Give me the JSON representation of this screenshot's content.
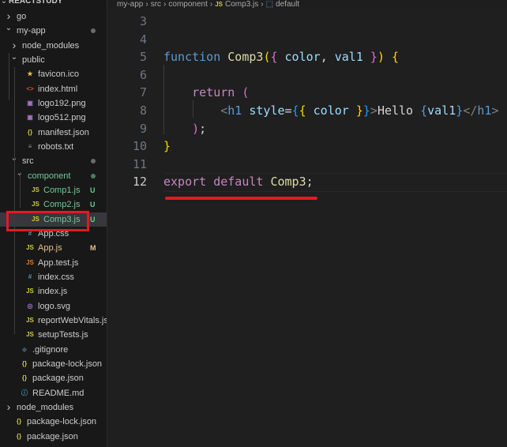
{
  "explorer": {
    "root_label": "REACTSTUDY",
    "items": [
      {
        "label": "go",
        "kind": "folder",
        "depth": 0,
        "collapsed": true
      },
      {
        "label": "my-app",
        "kind": "folder",
        "depth": 0,
        "collapsed": false,
        "dot": true
      },
      {
        "label": "node_modules",
        "kind": "folder",
        "depth": 1,
        "collapsed": true
      },
      {
        "label": "public",
        "kind": "folder",
        "depth": 1,
        "collapsed": false
      },
      {
        "label": "favicon.ico",
        "kind": "file",
        "depth": 2,
        "icon": "★",
        "icon_color": "#e8c44b"
      },
      {
        "label": "index.html",
        "kind": "file",
        "depth": 2,
        "icon": "<>",
        "icon_color": "#e44d26"
      },
      {
        "label": "logo192.png",
        "kind": "file",
        "depth": 2,
        "icon": "▣",
        "icon_color": "#a074c4"
      },
      {
        "label": "logo512.png",
        "kind": "file",
        "depth": 2,
        "icon": "▣",
        "icon_color": "#a074c4"
      },
      {
        "label": "manifest.json",
        "kind": "file",
        "depth": 2,
        "icon": "{}",
        "icon_color": "#cbcb41"
      },
      {
        "label": "robots.txt",
        "kind": "file",
        "depth": 2,
        "icon": "≡",
        "icon_color": "#8e8e8e"
      },
      {
        "label": "src",
        "kind": "folder",
        "depth": 1,
        "collapsed": false,
        "dot": true
      },
      {
        "label": "component",
        "kind": "folder",
        "depth": 2,
        "collapsed": false,
        "dot": true,
        "label_color": "#73c991"
      },
      {
        "label": "Comp1.js",
        "kind": "file",
        "depth": 3,
        "icon": "JS",
        "icon_color": "#cbcb41",
        "label_color": "#73c991",
        "badge": "U"
      },
      {
        "label": "Comp2.js",
        "kind": "file",
        "depth": 3,
        "icon": "JS",
        "icon_color": "#cbcb41",
        "label_color": "#73c991",
        "badge": "U"
      },
      {
        "label": "Comp3.js",
        "kind": "file",
        "depth": 3,
        "icon": "JS",
        "icon_color": "#cbcb41",
        "label_color": "#73c991",
        "badge": "U",
        "selected": true
      },
      {
        "label": "App.css",
        "kind": "file",
        "depth": 2,
        "icon": "#",
        "icon_color": "#519aba"
      },
      {
        "label": "App.js",
        "kind": "file",
        "depth": 2,
        "icon": "JS",
        "icon_color": "#cbcb41",
        "label_color": "#e2c08d",
        "badge": "M"
      },
      {
        "label": "App.test.js",
        "kind": "file",
        "depth": 2,
        "icon": "JS",
        "icon_color": "#e37933"
      },
      {
        "label": "index.css",
        "kind": "file",
        "depth": 2,
        "icon": "#",
        "icon_color": "#519aba"
      },
      {
        "label": "index.js",
        "kind": "file",
        "depth": 2,
        "icon": "JS",
        "icon_color": "#cbcb41"
      },
      {
        "label": "logo.svg",
        "kind": "file",
        "depth": 2,
        "icon": "◎",
        "icon_color": "#a074c4"
      },
      {
        "label": "reportWebVitals.js",
        "kind": "file",
        "depth": 2,
        "icon": "JS",
        "icon_color": "#cbcb41"
      },
      {
        "label": "setupTests.js",
        "kind": "file",
        "depth": 2,
        "icon": "JS",
        "icon_color": "#cbcb41"
      },
      {
        "label": ".gitignore",
        "kind": "file",
        "depth": 1,
        "icon": "◆",
        "icon_color": "#41535b"
      },
      {
        "label": "package-lock.json",
        "kind": "file",
        "depth": 1,
        "icon": "{}",
        "icon_color": "#cbcb41"
      },
      {
        "label": "package.json",
        "kind": "file",
        "depth": 1,
        "icon": "{}",
        "icon_color": "#cbcb41"
      },
      {
        "label": "README.md",
        "kind": "file",
        "depth": 1,
        "icon": "ⓘ",
        "icon_color": "#519aba"
      },
      {
        "label": "node_modules",
        "kind": "folder",
        "depth": 0,
        "collapsed": true
      },
      {
        "label": "package-lock.json",
        "kind": "file",
        "depth": 0,
        "icon": "{}",
        "icon_color": "#cbcb41"
      },
      {
        "label": "package.json",
        "kind": "file",
        "depth": 0,
        "icon": "{}",
        "icon_color": "#cbcb41"
      }
    ]
  },
  "breadcrumb": {
    "parts": [
      "my-app",
      "›",
      "src",
      "›",
      "component",
      "›",
      "JS",
      "Comp3.js",
      "›",
      "⬚",
      "default"
    ]
  },
  "editor": {
    "lines": [
      {
        "num": "3",
        "tokens": []
      },
      {
        "num": "4",
        "tokens": []
      },
      {
        "num": "5",
        "tokens": [
          [
            "function",
            "tag"
          ],
          [
            " ",
            "txt"
          ],
          [
            "Comp3",
            "fn"
          ],
          [
            "(",
            "br1"
          ],
          [
            "{",
            "br2"
          ],
          [
            " ",
            "txt"
          ],
          [
            "color",
            "var"
          ],
          [
            ", ",
            "txt"
          ],
          [
            "val1",
            "var"
          ],
          [
            " ",
            "txt"
          ],
          [
            "}",
            "br2"
          ],
          [
            ")",
            "br1"
          ],
          [
            " ",
            "txt"
          ],
          [
            "{",
            "br1"
          ]
        ]
      },
      {
        "num": "6",
        "tokens": []
      },
      {
        "num": "7",
        "tokens": [
          [
            "    ",
            "txt"
          ],
          [
            "return",
            "kw"
          ],
          [
            " ",
            "txt"
          ],
          [
            "(",
            "br2"
          ]
        ]
      },
      {
        "num": "8",
        "tokens": [
          [
            "        ",
            "txt"
          ],
          [
            "<",
            "gray"
          ],
          [
            "h1",
            "tag"
          ],
          [
            " ",
            "txt"
          ],
          [
            "style",
            "var"
          ],
          [
            "=",
            "txt"
          ],
          [
            "{",
            "br3"
          ],
          [
            "{",
            "br1"
          ],
          [
            " ",
            "txt"
          ],
          [
            "color",
            "var"
          ],
          [
            " ",
            "txt"
          ],
          [
            "}",
            "br1"
          ],
          [
            "}",
            "br3"
          ],
          [
            ">",
            "gray"
          ],
          [
            "Hello ",
            "txt"
          ],
          [
            "{",
            "tag"
          ],
          [
            "val1",
            "var"
          ],
          [
            "}",
            "tag"
          ],
          [
            "</",
            "gray"
          ],
          [
            "h1",
            "tag"
          ],
          [
            ">",
            "gray"
          ]
        ]
      },
      {
        "num": "9",
        "tokens": [
          [
            "    ",
            "txt"
          ],
          [
            ")",
            "br2"
          ],
          [
            ";",
            "txt"
          ]
        ]
      },
      {
        "num": "10",
        "tokens": [
          [
            "}",
            "br1"
          ]
        ]
      },
      {
        "num": "11",
        "tokens": []
      },
      {
        "num": "12",
        "tokens": [
          [
            "export",
            "kw"
          ],
          [
            " ",
            "txt"
          ],
          [
            "default",
            "kw"
          ],
          [
            " ",
            "txt"
          ],
          [
            "Comp3",
            "fn"
          ],
          [
            ";",
            "txt"
          ]
        ],
        "active": true
      }
    ]
  },
  "colors": {
    "annotation_red": "#e01b24",
    "sidebar_bg": "#181818",
    "editor_bg": "#1f1f1f"
  }
}
